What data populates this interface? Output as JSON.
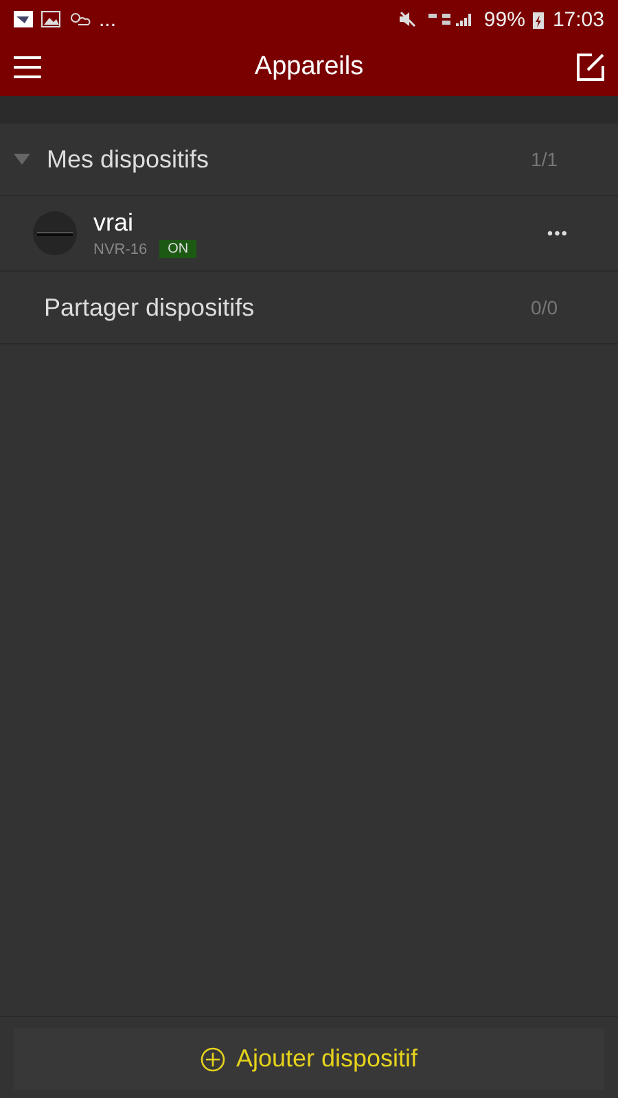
{
  "status_bar": {
    "more": "...",
    "battery": "99%",
    "time": "17:03"
  },
  "header": {
    "title": "Appareils"
  },
  "groups": [
    {
      "title": "Mes dispositifs",
      "count": "1/1",
      "expanded": true,
      "devices": [
        {
          "name": "vrai",
          "model": "NVR-16",
          "status": "ON",
          "more": "•••"
        }
      ]
    },
    {
      "title": "Partager dispositifs",
      "count": "0/0",
      "expanded": false
    }
  ],
  "add_button": {
    "label": "Ajouter dispositif"
  }
}
